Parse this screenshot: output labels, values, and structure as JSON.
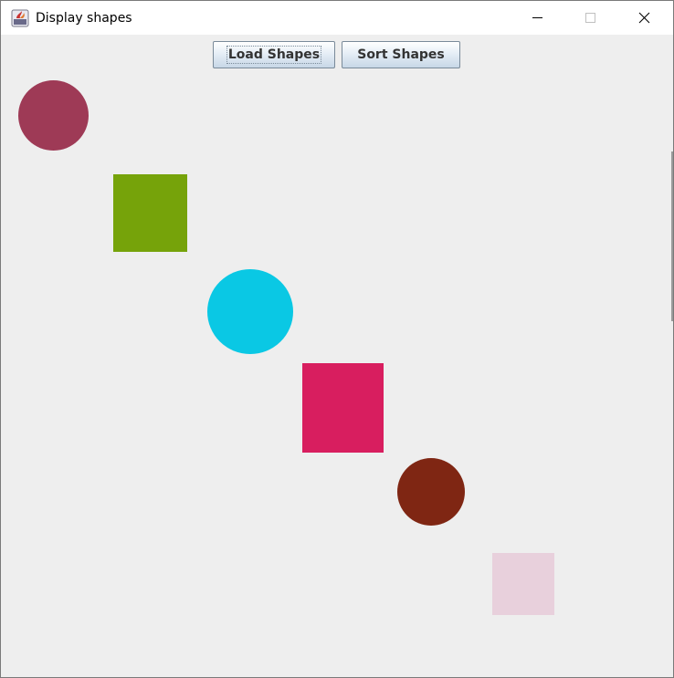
{
  "window": {
    "title": "Display shapes",
    "icon": "java-app-icon",
    "controls": [
      "minimize-icon",
      "maximize-icon",
      "close-icon"
    ]
  },
  "toolbar": {
    "load_label": "Load Shapes",
    "sort_label": "Sort Shapes"
  },
  "shapes": [
    {
      "type": "circle",
      "color": "#9e3a56"
    },
    {
      "type": "square",
      "color": "#76a30a"
    },
    {
      "type": "circle",
      "color": "#0ac8e4"
    },
    {
      "type": "square",
      "color": "#d81e5f"
    },
    {
      "type": "circle",
      "color": "#7f2613"
    },
    {
      "type": "square",
      "color": "#e8d0dc"
    }
  ]
}
